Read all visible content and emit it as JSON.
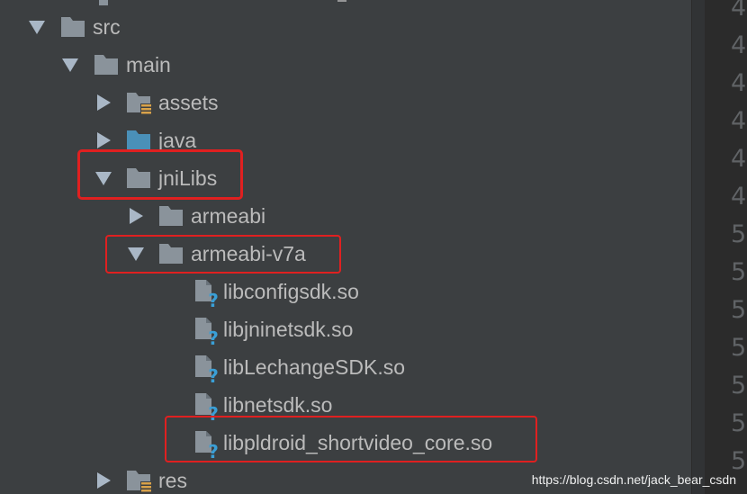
{
  "tree": {
    "nodes": [
      {
        "label": "src",
        "expanded": true,
        "icon": "folder-icon"
      },
      {
        "label": "main",
        "expanded": true,
        "icon": "folder-icon"
      },
      {
        "label": "assets",
        "expanded": false,
        "icon": "assets-folder-icon"
      },
      {
        "label": "java",
        "expanded": false,
        "icon": "source-folder-icon"
      },
      {
        "label": "jniLibs",
        "expanded": true,
        "icon": "folder-icon"
      },
      {
        "label": "armeabi",
        "expanded": false,
        "icon": "folder-icon"
      },
      {
        "label": "armeabi-v7a",
        "expanded": true,
        "icon": "folder-icon"
      },
      {
        "label": "libconfigsdk.so",
        "icon": "unknown-file-icon"
      },
      {
        "label": "libjninetsdk.so",
        "icon": "unknown-file-icon"
      },
      {
        "label": "libLechangeSDK.so",
        "icon": "unknown-file-icon"
      },
      {
        "label": "libnetsdk.so",
        "icon": "unknown-file-icon"
      },
      {
        "label": "libpldroid_shortvideo_core.so",
        "icon": "unknown-file-icon"
      },
      {
        "label": "res",
        "expanded": false,
        "icon": "resources-folder-icon"
      }
    ]
  },
  "gutter": {
    "line_numbers": [
      "4",
      "4",
      "4",
      "4",
      "4",
      "4",
      "5",
      "5",
      "5",
      "5",
      "5",
      "5",
      "5"
    ]
  },
  "colors": {
    "panel_bg": "#3c3f41",
    "gutter_bg": "#2b2b2b",
    "text": "#bbbbbb",
    "folder": "#8a939b",
    "source_folder": "#4a90b8",
    "highlight": "#e02020"
  },
  "watermark": "https://blog.csdn.net/jack_bear_csdn"
}
